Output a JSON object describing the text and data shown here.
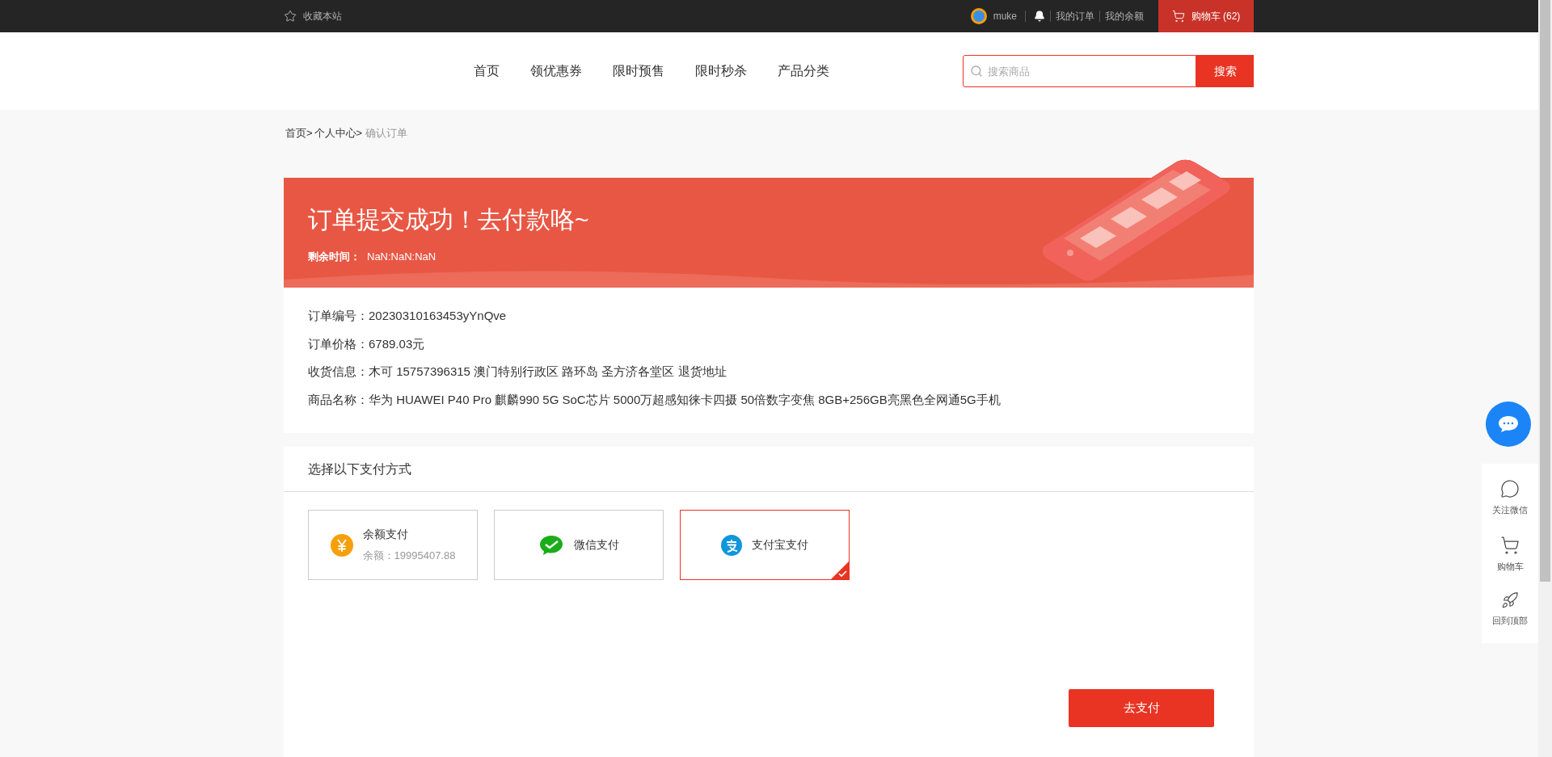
{
  "top_bar": {
    "favorite": "收藏本站",
    "username": "muke",
    "links": [
      "我的订单",
      "我的余额"
    ],
    "cart": "购物车 (62)"
  },
  "nav": {
    "items": [
      {
        "label": "首页",
        "selected": false
      },
      {
        "label": "领优惠券",
        "selected": false
      },
      {
        "label": "限时预售",
        "selected": false
      },
      {
        "label": "限时秒杀",
        "selected": false
      },
      {
        "label": "产品分类",
        "selected": false
      }
    ],
    "search_placeholder": "搜索商品",
    "search_button": "搜索"
  },
  "breadcrumb": [
    {
      "label": "首页>",
      "current": false
    },
    {
      "label": "个人中心>",
      "current": false
    },
    {
      "label": "确认订单",
      "current": true
    }
  ],
  "banner": {
    "title": "订单提交成功！去付款咯~",
    "countdown_label": "剩余时间：",
    "countdown": "NaN:NaN:NaN"
  },
  "order_info": [
    {
      "label": "订单编号：",
      "value": "20230310163453yYnQve"
    },
    {
      "label": "订单价格：",
      "value": "6789.03元"
    },
    {
      "label": "收货信息：",
      "value": "木可 15757396315 澳门特别行政区 路环岛 圣方济各堂区 退货地址"
    },
    {
      "label": "商品名称：",
      "value": "华为 HUAWEI P40 Pro 麒麟990 5G SoC芯片 5000万超感知徕卡四摄 50倍数字变焦 8GB+256GB亮黑色全网通5G手机"
    }
  ],
  "payment": {
    "title": "选择以下支付方式",
    "methods": [
      {
        "kind": "balance",
        "label": "余额支付",
        "sub": "余额：19995407.88",
        "selected": false
      },
      {
        "kind": "wechat",
        "label": "微信支付",
        "selected": false
      },
      {
        "kind": "alipay",
        "label": "支付宝支付",
        "selected": true
      }
    ],
    "pay_button": "去支付"
  },
  "side_tools": [
    {
      "kind": "wechat",
      "label": "关注微信"
    },
    {
      "kind": "cart",
      "label": "购物车"
    },
    {
      "kind": "top",
      "label": "回到顶部"
    }
  ]
}
